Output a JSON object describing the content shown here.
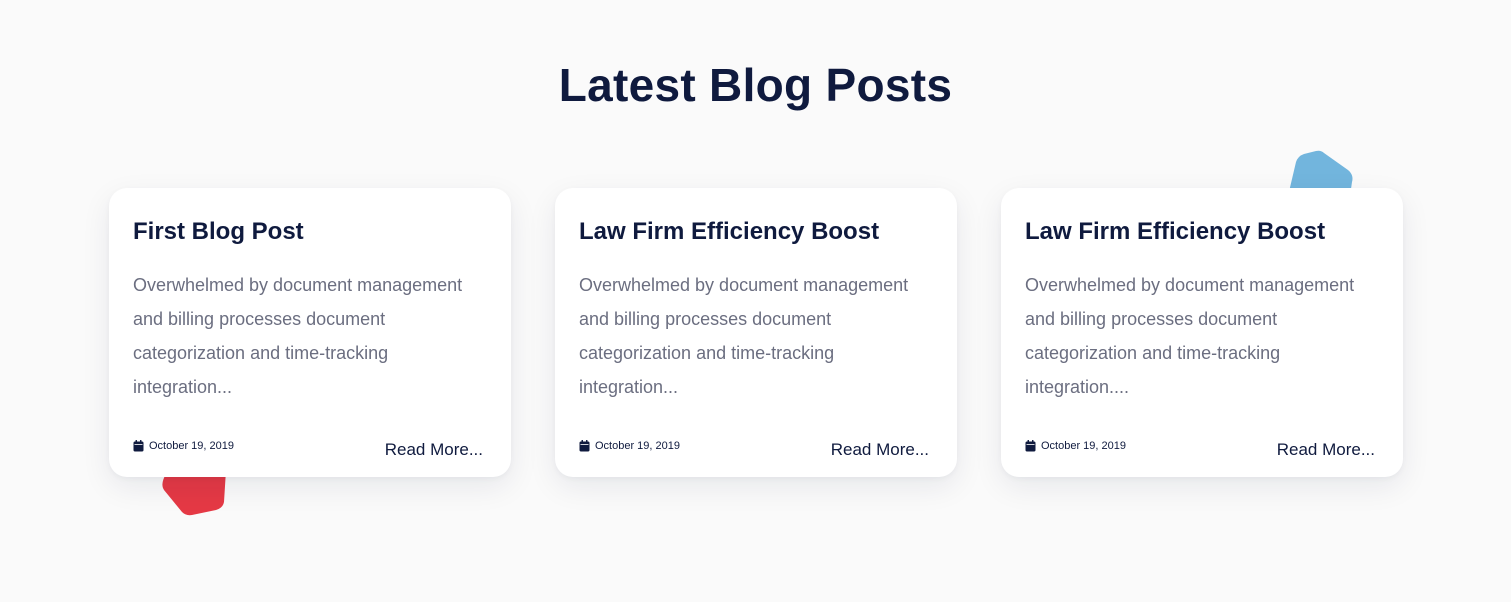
{
  "section": {
    "title": "Latest Blog Posts"
  },
  "colors": {
    "heading": "#0f1a3e",
    "body_text": "#6b6e80",
    "background": "#fafafa",
    "card": "#ffffff",
    "blob_red": "#e53945",
    "blob_blue": "#72b5dd"
  },
  "posts": [
    {
      "title": "First Blog Post",
      "excerpt": "Overwhelmed by document management and billing processes document categorization and time-tracking integration...",
      "date": "October 19, 2019",
      "read_more": "Read More...",
      "date_icon": "calendar-icon"
    },
    {
      "title": "Law Firm Efficiency Boost",
      "excerpt": "Overwhelmed by document management and billing processes document categorization and time-tracking integration...",
      "date": "October 19, 2019",
      "read_more": "Read More...",
      "date_icon": "calendar-icon"
    },
    {
      "title": "Law Firm Efficiency Boost",
      "excerpt": "Overwhelmed by document management and billing processes document categorization and time-tracking integration....",
      "date": "October 19, 2019",
      "read_more": "Read More...",
      "date_icon": "calendar-icon"
    }
  ]
}
